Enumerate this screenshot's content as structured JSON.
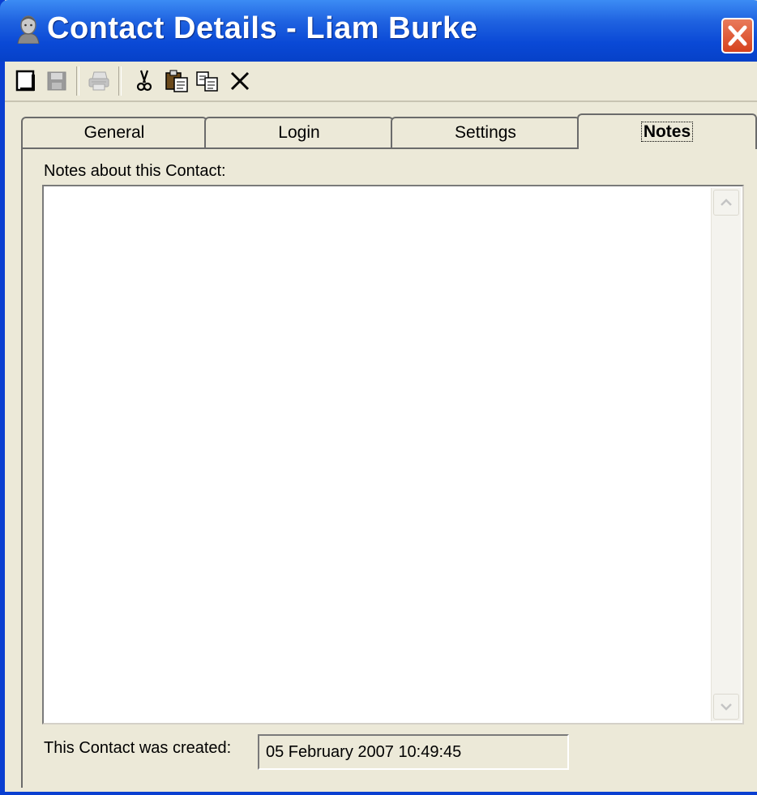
{
  "window": {
    "title": "Contact Details - Liam Burke",
    "title_icon": "contact-person-icon",
    "close_icon": "close-icon"
  },
  "toolbar": {
    "buttons": [
      {
        "icon": "new-document-icon",
        "enabled": true
      },
      {
        "icon": "save-disk-icon",
        "enabled": false
      },
      {
        "icon": "print-icon",
        "enabled": false
      },
      {
        "icon": "cut-scissors-icon",
        "enabled": true
      },
      {
        "icon": "paste-clipboard-icon",
        "enabled": true
      },
      {
        "icon": "copy-icon",
        "enabled": true
      },
      {
        "icon": "delete-x-icon",
        "enabled": true
      }
    ]
  },
  "tabs": {
    "general": "General",
    "login": "Login",
    "settings": "Settings",
    "notes": "Notes",
    "active": "Notes"
  },
  "notes": {
    "label": "Notes about this Contact:",
    "value": ""
  },
  "created": {
    "label": "This Contact was created:",
    "value": "05 February 2007 10:49:45"
  },
  "colors": {
    "title_bar": "#0A49D6",
    "window_face": "#ECE9D8",
    "close_button": "#D6421E"
  }
}
